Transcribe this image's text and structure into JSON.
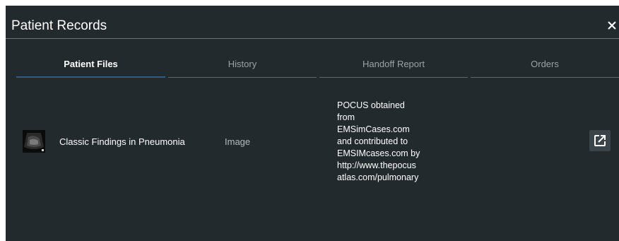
{
  "modal": {
    "title": "Patient Records",
    "close_icon": "close-icon"
  },
  "tabs": [
    {
      "label": "Patient Files",
      "active": true
    },
    {
      "label": "History",
      "active": false
    },
    {
      "label": "Handoff Report",
      "active": false
    },
    {
      "label": "Orders",
      "active": false
    }
  ],
  "records": [
    {
      "thumbnail_icon": "ultrasound-thumbnail",
      "name": "Classic Findings in Pneumonia",
      "type": "Image",
      "source": "POCUS obtained\nfrom\nEMSimCases.com\nand contributed to\nEMSIMcases.com by\nhttp://www.thepocus\natlas.com/pulmonary",
      "action_icon": "open-external-icon"
    }
  ],
  "colors": {
    "background": "#232a2e",
    "active_tab_underline": "#2c5f86",
    "button_bg": "#3b4448"
  }
}
